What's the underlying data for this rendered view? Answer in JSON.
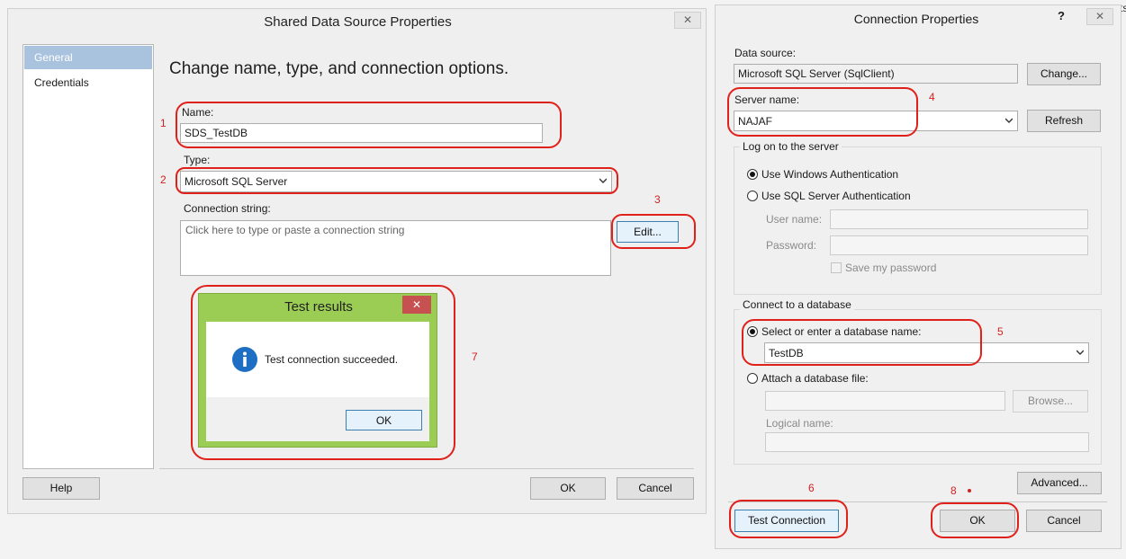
{
  "shared_dialog": {
    "title": "Shared Data Source Properties",
    "close_glyph": "✕",
    "nav": [
      {
        "label": "General",
        "selected": true
      },
      {
        "label": "Credentials",
        "selected": false
      }
    ],
    "heading": "Change name, type, and connection options.",
    "name_label": "Name:",
    "name_value": "SDS_TestDB",
    "type_label": "Type:",
    "type_value": "Microsoft SQL Server",
    "conn_label": "Connection string:",
    "conn_placeholder": "Click here to type or paste a connection string",
    "edit_button": "Edit...",
    "help_button": "Help",
    "ok_button": "OK",
    "cancel_button": "Cancel"
  },
  "test_results": {
    "title": "Test results",
    "close_glyph": "✕",
    "message": "Test connection succeeded.",
    "ok_button": "OK",
    "info_icon": "info-icon"
  },
  "connection_dialog": {
    "title": "Connection Properties",
    "help_glyph": "?",
    "close_glyph": "✕",
    "data_source_label": "Data source:",
    "data_source_value": "Microsoft SQL Server (SqlClient)",
    "change_button": "Change...",
    "server_name_label": "Server name:",
    "server_name_value": "NAJAF",
    "refresh_button": "Refresh",
    "logon_group": "Log on to the server",
    "auth_windows": "Use Windows Authentication",
    "auth_sql": "Use SQL Server Authentication",
    "username_label": "User name:",
    "password_label": "Password:",
    "save_password": "Save my password",
    "db_group": "Connect to a database",
    "select_db_label": "Select or enter a database name:",
    "db_value": "TestDB",
    "attach_label": "Attach a database file:",
    "browse_button": "Browse...",
    "logical_name_label": "Logical name:",
    "advanced_button": "Advanced...",
    "test_connection_button": "Test Connection",
    "ok_button": "OK",
    "cancel_button": "Cancel"
  },
  "annotations": [
    "1",
    "2",
    "3",
    "4",
    "5",
    "6",
    "7",
    "8"
  ],
  "background_fragment": "ts",
  "colors": {
    "annotation_red": "#e0201a",
    "selected_nav": "#a9c3df",
    "test_results_frame": "#9bcd54",
    "info_blue": "#1e6fc4",
    "close_red": "#c75050"
  }
}
